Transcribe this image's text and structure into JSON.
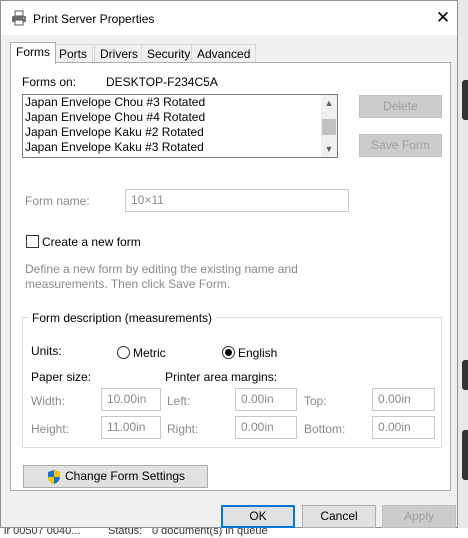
{
  "background": {
    "left_text": "ir 00507 0040...",
    "status_label": "Status:",
    "status_value": "0 document(s) in queue"
  },
  "window": {
    "title": "Print Server Properties",
    "close_glyph": "✕"
  },
  "tabs": [
    {
      "label": "Forms",
      "active": true
    },
    {
      "label": "Ports"
    },
    {
      "label": "Drivers"
    },
    {
      "label": "Security"
    },
    {
      "label": "Advanced"
    }
  ],
  "forms": {
    "forms_on_label": "Forms on:",
    "server_name": "DESKTOP-F234C5A",
    "list_items": [
      "Japan Envelope Chou #3 Rotated",
      "Japan Envelope Chou #4 Rotated",
      "Japan Envelope Kaku #2 Rotated",
      "Japan Envelope Kaku #3 Rotated"
    ],
    "delete_label": "Delete",
    "save_form_label": "Save Form",
    "form_name_label": "Form name:",
    "form_name_value": "10×11",
    "create_new_form_label": "Create a new form",
    "create_new_form_checked": false,
    "hint_line1": "Define a new form by editing the existing name and",
    "hint_line2": "measurements. Then click Save Form."
  },
  "description": {
    "group_label": "Form description (measurements)",
    "units_label": "Units:",
    "metric_label": "Metric",
    "english_label": "English",
    "selected_unit": "English",
    "paper_size_label": "Paper size:",
    "printer_area_margins_label": "Printer area margins:",
    "width_label": "Width:",
    "width_value": "10.00in",
    "height_label": "Height:",
    "height_value": "11.00in",
    "left_label": "Left:",
    "left_value": "0.00in",
    "right_label": "Right:",
    "right_value": "0.00in",
    "top_label": "Top:",
    "top_value": "0.00in",
    "bottom_label": "Bottom:",
    "bottom_value": "0.00in"
  },
  "change_form_settings_label": "Change Form Settings",
  "footer": {
    "ok_label": "OK",
    "cancel_label": "Cancel",
    "apply_label": "Apply"
  },
  "colors": {
    "accent": "#0078d7",
    "shield_blue": "#1b6fd1",
    "shield_yellow": "#f2c400"
  }
}
